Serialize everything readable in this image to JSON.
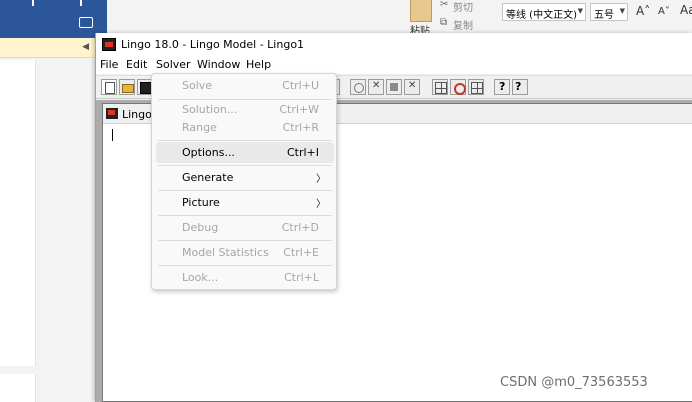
{
  "word": {
    "ribbon": {
      "paste_label": "粘贴",
      "cut_label": "剪切",
      "copy_label": "复制",
      "font_name": "等线 (中文正文)",
      "font_size": "五号",
      "grow_font": "A˄",
      "shrink_font": "A˅",
      "change_case": "Aa"
    }
  },
  "lingo": {
    "title": "Lingo 18.0 - Lingo Model - Lingo1",
    "menu": [
      "File",
      "Edit",
      "Solver",
      "Window",
      "Help"
    ],
    "child_window_title": "Lingo",
    "solver_menu": {
      "items": [
        {
          "label": "Solve",
          "shortcut": "Ctrl+U",
          "enabled": false
        },
        {
          "label": "Solution...",
          "shortcut": "Ctrl+W",
          "enabled": false
        },
        {
          "label": "Range",
          "shortcut": "Ctrl+R",
          "enabled": false
        },
        {
          "label": "Options...",
          "shortcut": "Ctrl+I",
          "enabled": true,
          "highlighted": true
        },
        {
          "label": "Generate",
          "shortcut": "",
          "enabled": true,
          "submenu": true
        },
        {
          "label": "Picture",
          "shortcut": "",
          "enabled": true,
          "submenu": true
        },
        {
          "label": "Debug",
          "shortcut": "Ctrl+D",
          "enabled": false
        },
        {
          "label": "Model Statistics",
          "shortcut": "Ctrl+E",
          "enabled": false
        },
        {
          "label": "Look...",
          "shortcut": "Ctrl+L",
          "enabled": false
        }
      ]
    }
  },
  "watermark": "CSDN @m0_73563553",
  "icons": {
    "submenu_arrow": "chevron-right-icon",
    "app": "lingo-app-icon"
  }
}
